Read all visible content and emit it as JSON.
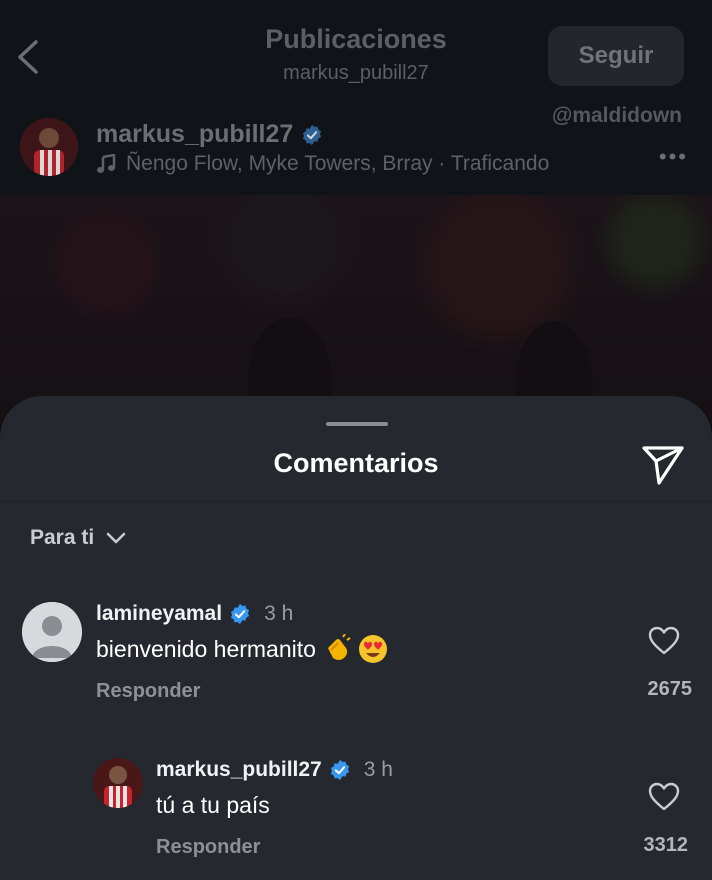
{
  "header": {
    "title": "Publicaciones",
    "subtitle": "markus_pubill27",
    "follow_label": "Seguir",
    "watermark": "@maldidown",
    "back_icon": "chevron-left-icon"
  },
  "post": {
    "author": "markus_pubill27",
    "music": "Ñengo Flow, Myke Towers, Brray · Traficando",
    "more_label": "•••"
  },
  "sheet": {
    "title": "Comentarios",
    "sort_label": "Para ti"
  },
  "comments": [
    {
      "user": "lamineyamal",
      "time": "3 h",
      "text": "bienvenido hermanito",
      "reply_label": "Responder",
      "likes": "2675"
    },
    {
      "user": "markus_pubill27",
      "time": "3 h",
      "text": "tú a tu país",
      "reply_label": "Responder",
      "likes": "3312"
    }
  ],
  "colors": {
    "sheet_bg": "#25282e",
    "verified": "#3897f0"
  }
}
